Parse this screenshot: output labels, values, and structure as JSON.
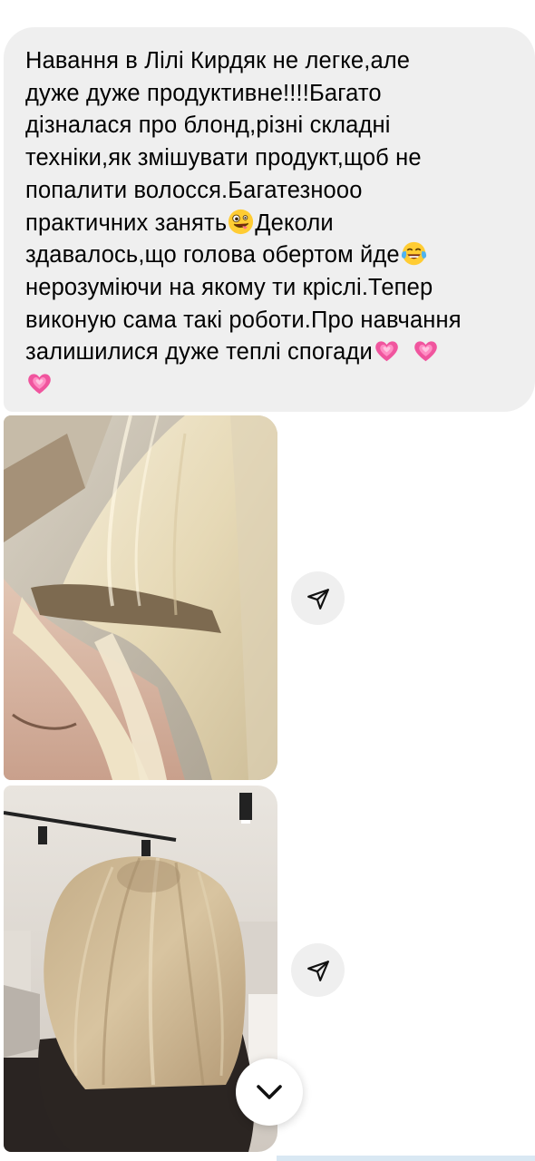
{
  "message": {
    "lines": [
      "Навання в Лілі Кирдяк не легке,але",
      "дуже дуже продуктивне!!!!Багато",
      "дізналася про блонд,різні складні",
      "техніки,як змішувати продукт,щоб не",
      "попалити волосся.Багатезнооо",
      "практичних занять",
      "Деколи",
      "здавалось,що голова обертом йде",
      "нерозуміючи на якому ти кріслі.Тепер",
      "виконую сама такі роботи.Про навчання",
      "залишилися дуже теплі спогади"
    ],
    "emoji": {
      "zany_face": "zany-face-emoji",
      "tears_of_joy": "tears-of-joy-emoji",
      "growing_heart": "growing-heart-emoji"
    }
  },
  "photos": [
    {
      "subject": "blonde hair roots close-up"
    },
    {
      "subject": "blonde bob haircut from behind"
    }
  ],
  "icons": {
    "share": "paper-plane-share-icon",
    "scroll_down": "chevron-down-icon"
  },
  "colors": {
    "bubble": "#efefef",
    "text": "#000000",
    "background": "#ffffff",
    "heart_pink": "#f0559e"
  }
}
